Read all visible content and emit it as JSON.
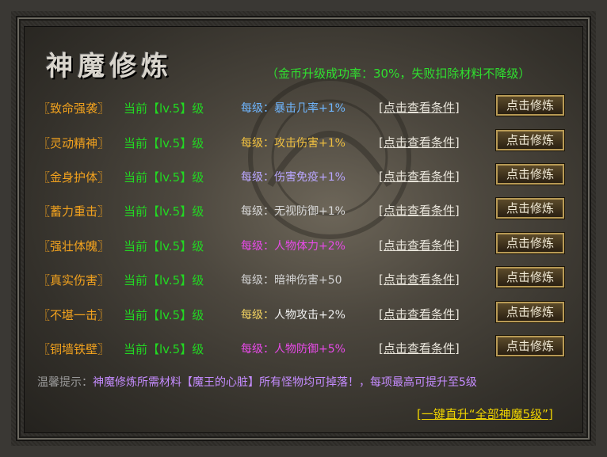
{
  "title": "神魔修炼",
  "rate_note": "（金币升级成功率：30%，失败扣除材料不降级）",
  "link_label": "[点击查看条件]",
  "button_label": "点击修炼",
  "rows": [
    {
      "name": "〖致命强袭〗",
      "level": "当前【lv.5】级",
      "bonus_prefix": "每级：",
      "bonus": "暴击几率+1%",
      "prefix_color": "#6fb6ff",
      "bonus_color": "#6fb6ff"
    },
    {
      "name": "〖灵动精神〗",
      "level": "当前【lv.5】级",
      "bonus_prefix": "每级：",
      "bonus": "攻击伤害+1%",
      "prefix_color": "#f0c040",
      "bonus_color": "#f0c040"
    },
    {
      "name": "〖金身护体〗",
      "level": "当前【lv.5】级",
      "bonus_prefix": "每级：",
      "bonus": "伤害免疫+1%",
      "prefix_color": "#b9a6ff",
      "bonus_color": "#b9a6ff"
    },
    {
      "name": "〖蓄力重击〗",
      "level": "当前【lv.5】级",
      "bonus_prefix": "每级：",
      "bonus": "无视防御+1%",
      "prefix_color": "#d8d8d8",
      "bonus_color": "#d8d8d8"
    },
    {
      "name": "〖强壮体魄〗",
      "level": "当前【lv.5】级",
      "bonus_prefix": "每级：",
      "bonus": "人物体力+2%",
      "prefix_color": "#e84ae8",
      "bonus_color": "#e84ae8"
    },
    {
      "name": "〖真实伤害〗",
      "level": "当前【lv.5】级",
      "bonus_prefix": "每级：",
      "bonus": "暗神伤害+50",
      "prefix_color": "#d0d0d0",
      "bonus_color": "#d0d0d0"
    },
    {
      "name": "〖不堪一击〗",
      "level": "当前【lv.5】级",
      "bonus_prefix": "每级：",
      "bonus": "人物攻击+2%",
      "prefix_color": "#f0d060",
      "bonus_color": "#f0f0f0"
    },
    {
      "name": "〖铜墙铁壁〗",
      "level": "当前【lv.5】级",
      "bonus_prefix": "每级：",
      "bonus": "人物防御+5%",
      "prefix_color": "#e84ae8",
      "bonus_color": "#e84ae8"
    }
  ],
  "tip_label": "温馨提示：",
  "tip_text": "神魔修炼所需材料【魔王的心脏】所有怪物均可掉落！，每项最高可提升至5级",
  "one_click": "[一键直升“全部神魔5级”]"
}
